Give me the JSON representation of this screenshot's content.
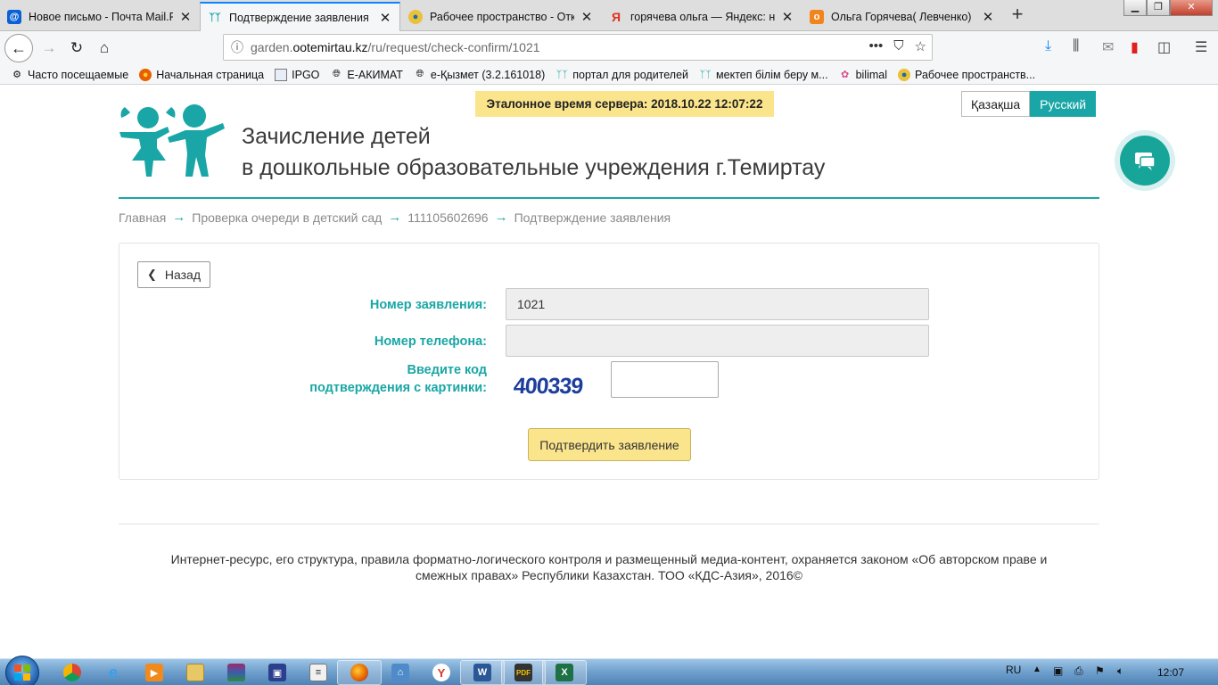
{
  "tabs": [
    {
      "title": "Новое письмо - Почта Mail.Ru",
      "active": false,
      "icon": "mail-ru-icon"
    },
    {
      "title": "Подтверждение заявления",
      "active": true,
      "icon": "children-icon"
    },
    {
      "title": "Рабочее пространство - Откр",
      "active": false,
      "icon": "gov-icon"
    },
    {
      "title": "горячева ольга — Яндекс: на",
      "active": false,
      "icon": "yandex-icon"
    },
    {
      "title": "Ольга Горячева( Левченко)",
      "active": false,
      "icon": "odnoklassniki-icon"
    }
  ],
  "address": {
    "prefix": "garden.",
    "host": "ootemirtau.kz",
    "path": "/ru/request/check-confirm/1021",
    "more": "•••"
  },
  "bookmarks": [
    {
      "label": "Часто посещаемые",
      "icon": "gear-icon"
    },
    {
      "label": "Начальная страница",
      "icon": "firefox-icon"
    },
    {
      "label": "IPGO",
      "icon": "page-icon"
    },
    {
      "label": "Е-АКИМАТ",
      "icon": "globe-icon"
    },
    {
      "label": "e-Қызмет (3.2.161018)",
      "icon": "globe-icon"
    },
    {
      "label": "портал для родителей",
      "icon": "children-icon"
    },
    {
      "label": "мектеп білім беру м...",
      "icon": "children-icon"
    },
    {
      "label": "bilimal",
      "icon": "bilimal-icon"
    },
    {
      "label": "Рабочее пространств...",
      "icon": "gov-icon"
    }
  ],
  "header": {
    "server_time": "Эталонное время сервера: 2018.10.22 12:07:22",
    "lang_kz": "Қазақша",
    "lang_ru": "Русский",
    "title_line1": "Зачисление детей",
    "title_line2": "в дошкольные образовательные учреждения г.Темиртау"
  },
  "breadcrumb": [
    "Главная",
    "Проверка очереди в детский сад",
    "111105602696",
    "Подтверждение заявления"
  ],
  "form": {
    "back_label": "Назад",
    "application_label": "Номер заявления:",
    "application_value": "1021",
    "phone_label": "Номер телефона:",
    "phone_value": "",
    "captcha_label_1": "Введите код",
    "captcha_label_2": "подтверждения с картинки:",
    "captcha_text": "400339",
    "submit_label": "Подтвердить заявление"
  },
  "footer": {
    "line1": "Интернет-ресурс, его структура, правила форматно-логического контроля и размещенный медиа-контент, охраняется законом «Об авторском праве и",
    "line2": "смежных правах» Республики Казахстан. ТОО «КДС-Азия», 2016©"
  },
  "taskbar": {
    "lang": "RU",
    "time": "12:07"
  },
  "colors": {
    "accent": "#1aa6a6",
    "highlight": "#fbe58c"
  }
}
